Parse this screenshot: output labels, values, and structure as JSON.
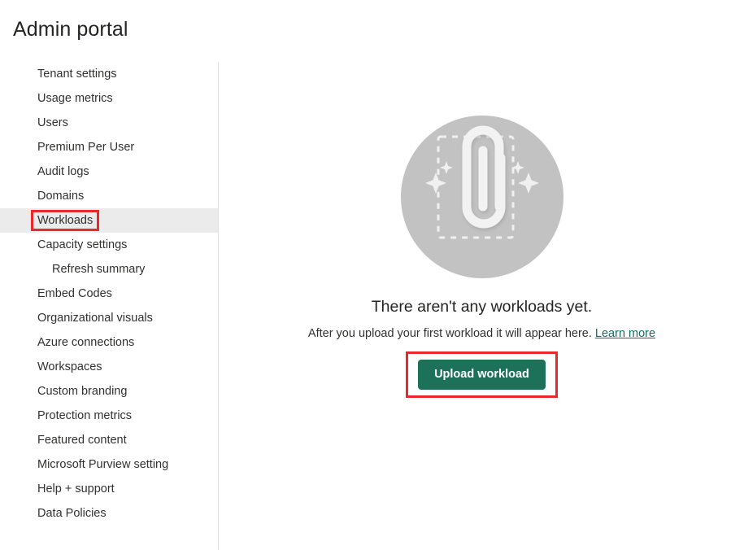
{
  "header": {
    "title": "Admin portal"
  },
  "sidebar": {
    "items": [
      {
        "label": "Tenant settings",
        "sub": false,
        "selected": false,
        "annotated": false
      },
      {
        "label": "Usage metrics",
        "sub": false,
        "selected": false,
        "annotated": false
      },
      {
        "label": "Users",
        "sub": false,
        "selected": false,
        "annotated": false
      },
      {
        "label": "Premium Per User",
        "sub": false,
        "selected": false,
        "annotated": false
      },
      {
        "label": "Audit logs",
        "sub": false,
        "selected": false,
        "annotated": false
      },
      {
        "label": "Domains",
        "sub": false,
        "selected": false,
        "annotated": false
      },
      {
        "label": "Workloads",
        "sub": false,
        "selected": true,
        "annotated": true
      },
      {
        "label": "Capacity settings",
        "sub": false,
        "selected": false,
        "annotated": false
      },
      {
        "label": "Refresh summary",
        "sub": true,
        "selected": false,
        "annotated": false
      },
      {
        "label": "Embed Codes",
        "sub": false,
        "selected": false,
        "annotated": false
      },
      {
        "label": "Organizational visuals",
        "sub": false,
        "selected": false,
        "annotated": false
      },
      {
        "label": "Azure connections",
        "sub": false,
        "selected": false,
        "annotated": false
      },
      {
        "label": "Workspaces",
        "sub": false,
        "selected": false,
        "annotated": false
      },
      {
        "label": "Custom branding",
        "sub": false,
        "selected": false,
        "annotated": false
      },
      {
        "label": "Protection metrics",
        "sub": false,
        "selected": false,
        "annotated": false
      },
      {
        "label": "Featured content",
        "sub": false,
        "selected": false,
        "annotated": false
      },
      {
        "label": "Microsoft Purview setting",
        "sub": false,
        "selected": false,
        "annotated": false
      },
      {
        "label": "Help + support",
        "sub": false,
        "selected": false,
        "annotated": false
      },
      {
        "label": "Data Policies",
        "sub": false,
        "selected": false,
        "annotated": false
      }
    ]
  },
  "main": {
    "illustration_icon": "paperclip-upload-illustration",
    "empty_title": "There aren't any workloads yet.",
    "empty_description": "After you upload your first workload it will appear here.",
    "learn_more_label": "Learn more",
    "upload_button_label": "Upload workload"
  },
  "colors": {
    "accent_green": "#1d7159",
    "link_teal": "#0f6e63",
    "annotation_red": "#e8282a",
    "selected_row": "#ebebeb",
    "illustration_circle": "#c2c2c2",
    "illustration_white": "#f2f2f2",
    "divider": "#e1e1e1",
    "text": "#323130"
  }
}
